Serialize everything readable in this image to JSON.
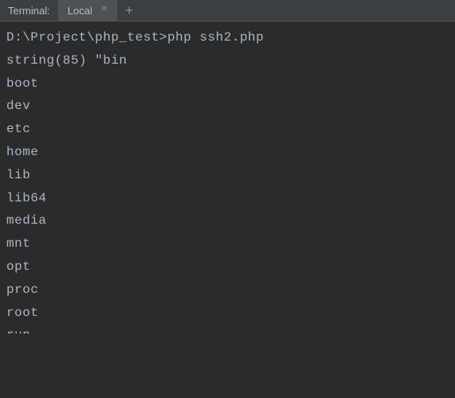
{
  "tab_bar": {
    "label": "Terminal:",
    "tabs": [
      {
        "label": "Local"
      }
    ]
  },
  "terminal": {
    "prompt_line": "D:\\Project\\php_test>php ssh2.php",
    "lines": [
      "string(85) \"bin",
      "boot",
      "dev",
      "etc",
      "home",
      "lib",
      "lib64",
      "media",
      "mnt",
      "opt",
      "proc",
      "root"
    ],
    "cut_line": "run"
  }
}
